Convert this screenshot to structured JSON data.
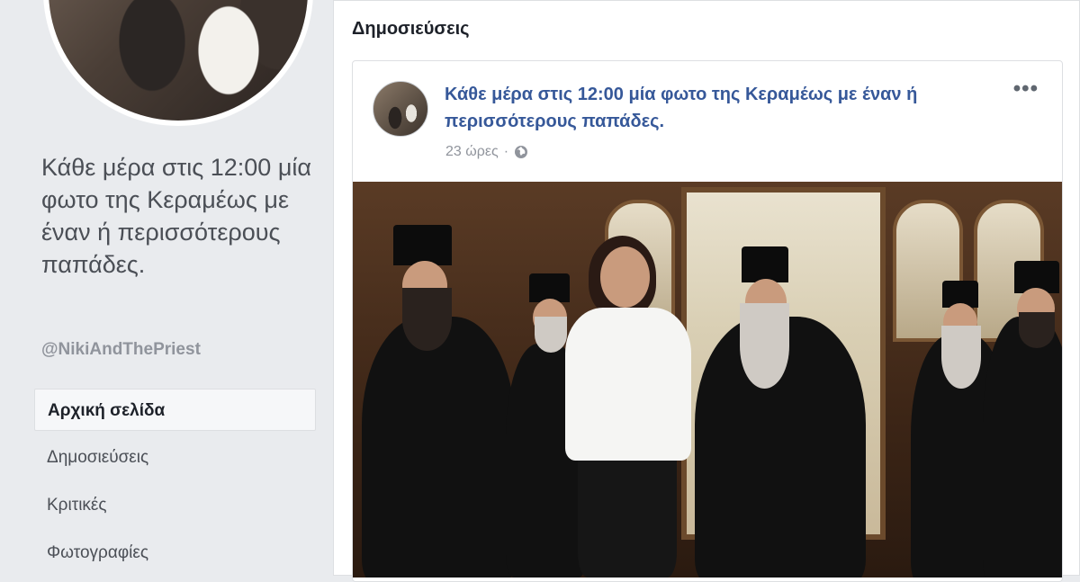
{
  "page": {
    "name": "Κάθε μέρα στις 12:00 μία φωτο της Κεραμέως με έναν ή περισσότερους παπάδες.",
    "handle": "@NikiAndThePriest"
  },
  "nav": {
    "items": [
      {
        "label": "Αρχική σελίδα",
        "active": true
      },
      {
        "label": "Δημοσιεύσεις",
        "active": false
      },
      {
        "label": "Κριτικές",
        "active": false
      },
      {
        "label": "Φωτογραφίες",
        "active": false
      }
    ]
  },
  "posts": {
    "header": "Δημοσιεύσεις",
    "post": {
      "title": "Κάθε μέρα στις 12:00 μία φωτο της Κεραμέως με έναν ή περισσότερους παπάδες.",
      "time": "23 ώρες",
      "separator": "·",
      "more": "•••"
    }
  },
  "colors": {
    "background": "#e9ebee",
    "link": "#365899",
    "muted": "#90949c"
  },
  "icons": [
    "globe-icon",
    "more-icon"
  ]
}
